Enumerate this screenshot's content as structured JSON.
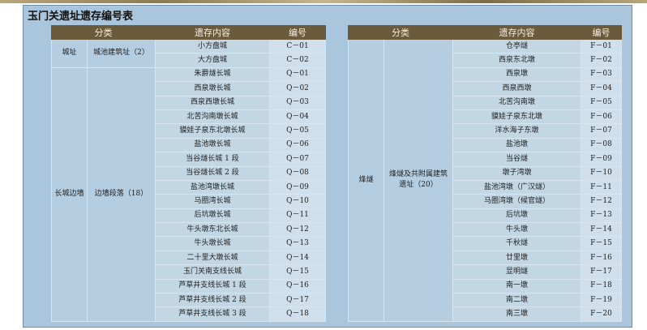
{
  "title": "玉门关遗址遗存编号表",
  "headers": {
    "category": "分类",
    "content": "遗存内容",
    "number": "编号"
  },
  "left": {
    "groups": [
      {
        "cat1": "城址",
        "cat2": "城池建筑址（2）"
      },
      {
        "cat1": "长城边墙",
        "cat2": "边墙段落（18）"
      }
    ],
    "rows": [
      {
        "name": "小方盘城",
        "code": "C－01"
      },
      {
        "name": "大方盘城",
        "code": "C－02"
      },
      {
        "name": "朱爵燧长城",
        "code": "Q－01"
      },
      {
        "name": "西泉墩长城",
        "code": "Q－02"
      },
      {
        "name": "西泉西墩长城",
        "code": "Q－03"
      },
      {
        "name": "北苦沟南墩长城",
        "code": "Q－04"
      },
      {
        "name": "貘娃子泉东北墩长城",
        "code": "Q－05"
      },
      {
        "name": "盐池墩长城",
        "code": "Q－06"
      },
      {
        "name": "当谷燧长城 1 段",
        "code": "Q－07"
      },
      {
        "name": "当谷燧长城 2 段",
        "code": "Q－08"
      },
      {
        "name": "盐池湾墩长城",
        "code": "Q－09"
      },
      {
        "name": "马圈湾长城",
        "code": "Q－10"
      },
      {
        "name": "后坑墩长城",
        "code": "Q－11"
      },
      {
        "name": "牛头墩东北长城",
        "code": "Q－12"
      },
      {
        "name": "牛头墩长城",
        "code": "Q－13"
      },
      {
        "name": "二十里大墩长城",
        "code": "Q－14"
      },
      {
        "name": "玉门关南支线长城",
        "code": "Q－15"
      },
      {
        "name": "芦草井支线长城 1 段",
        "code": "Q－16"
      },
      {
        "name": "芦草井支线长城 2 段",
        "code": "Q－17"
      },
      {
        "name": "芦草井支线长城 3 段",
        "code": "Q－18"
      }
    ]
  },
  "right": {
    "group": {
      "cat1": "烽燧",
      "cat2": "烽燧及共附属建筑遗址（20）"
    },
    "rows": [
      {
        "name": "仓亭燧",
        "code": "F－01"
      },
      {
        "name": "西泉东北墩",
        "code": "F－02"
      },
      {
        "name": "西泉墩",
        "code": "F－03"
      },
      {
        "name": "西泉西墩",
        "code": "F－04"
      },
      {
        "name": "北苦沟南墩",
        "code": "F－05"
      },
      {
        "name": "貘娃子泉东北墩",
        "code": "F－06"
      },
      {
        "name": "洋水海子东墩",
        "code": "F－07"
      },
      {
        "name": "盐池墩",
        "code": "F－08"
      },
      {
        "name": "当谷燧",
        "code": "F－09"
      },
      {
        "name": "墩子湾墩",
        "code": "F－10"
      },
      {
        "name": "盐池湾墩（广汉燧）",
        "code": "F－11"
      },
      {
        "name": "马圈湾墩（候官燧）",
        "code": "F－12"
      },
      {
        "name": "后坑墩",
        "code": "F－13"
      },
      {
        "name": "牛头墩",
        "code": "F－14"
      },
      {
        "name": "千秋燧",
        "code": "F－15"
      },
      {
        "name": "廿里墩",
        "code": "F－16"
      },
      {
        "name": "显明燧",
        "code": "F－17"
      },
      {
        "name": "南一墩",
        "code": "F－18"
      },
      {
        "name": "南二墩",
        "code": "F－19"
      },
      {
        "name": "南三墩",
        "code": "F－20"
      }
    ]
  }
}
